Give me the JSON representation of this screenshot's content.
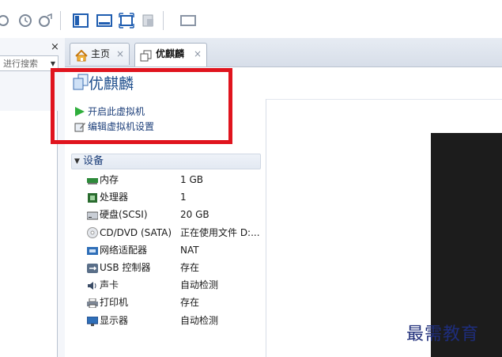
{
  "left_pane": {
    "close_glyph": "×",
    "search_placeholder": "进行搜索"
  },
  "tabs": [
    {
      "label": "主页",
      "close": "×"
    },
    {
      "label": "优麒麟",
      "close": "×"
    }
  ],
  "vm": {
    "name": "优麒麟",
    "actions": [
      {
        "label": "开启此虚拟机"
      },
      {
        "label": "编辑虚拟机设置"
      }
    ]
  },
  "devices": {
    "header": "设备",
    "rows": [
      {
        "name": "内存",
        "value": "1 GB"
      },
      {
        "name": "处理器",
        "value": "1"
      },
      {
        "name": "硬盘(SCSI)",
        "value": "20 GB"
      },
      {
        "name": "CD/DVD (SATA)",
        "value": "正在使用文件 D:..."
      },
      {
        "name": "网络适配器",
        "value": "NAT"
      },
      {
        "name": "USB 控制器",
        "value": "存在"
      },
      {
        "name": "声卡",
        "value": "自动检测"
      },
      {
        "name": "打印机",
        "value": "存在"
      },
      {
        "name": "显示器",
        "value": "自动检测"
      }
    ]
  },
  "watermark": "最需教育",
  "colors": {
    "highlight": "#e0141e",
    "accent": "#1e4e8c",
    "play": "#2fae3c"
  }
}
